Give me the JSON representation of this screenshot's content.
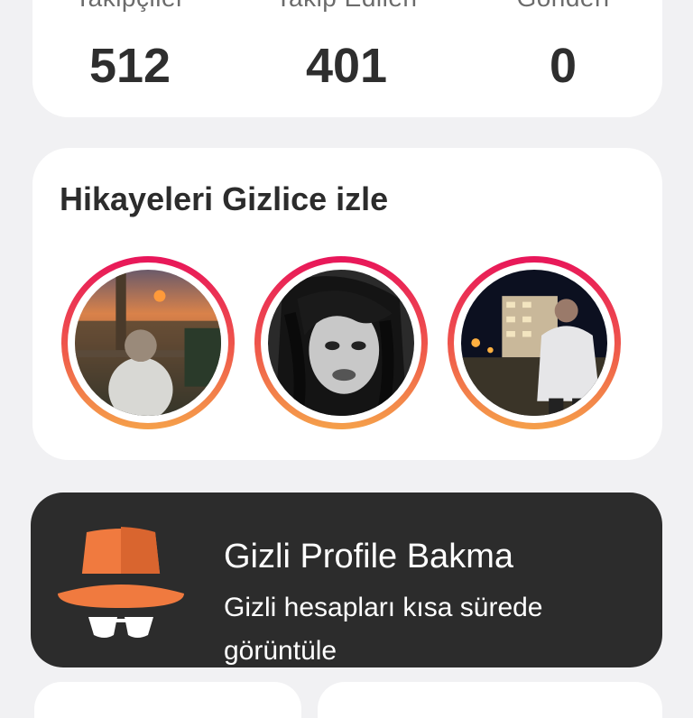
{
  "stats": {
    "items": [
      {
        "label": "Takipçiler",
        "value": "512"
      },
      {
        "label": "Takip Edilen",
        "value": "401"
      },
      {
        "label": "Gönderi",
        "value": "0"
      }
    ]
  },
  "stories": {
    "title": "Hikayeleri Gizlice izle",
    "ring_colors": [
      "#e8155a",
      "#f5a04a"
    ],
    "items": [
      {
        "icon": "story-avatar-sunset"
      },
      {
        "icon": "story-avatar-bw-portrait"
      },
      {
        "icon": "story-avatar-night-city"
      }
    ]
  },
  "hidden_profile": {
    "title": "Gizli Profile Bakma",
    "subtitle": "Gizli hesapları kısa sürede görüntüle",
    "icon": "spy-hat-icon",
    "accent_color": "#f07a3f"
  }
}
